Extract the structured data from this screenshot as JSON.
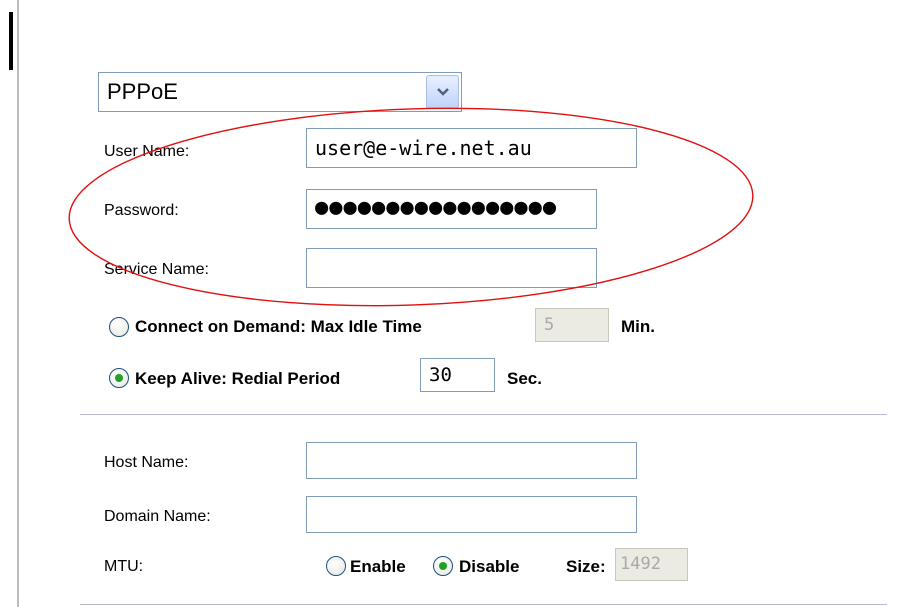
{
  "connection": {
    "type_options": [
      "PPPoE"
    ],
    "type_selected": "PPPoE"
  },
  "credentials": {
    "user_name_label": "User Name:",
    "user_name_value": "user@e-wire.net.au",
    "password_label": "Password:",
    "password_value": "●●●●●●●●●●●●●●●●●",
    "service_name_label": "Service Name:",
    "service_name_value": ""
  },
  "connect_mode": {
    "on_demand_label": "Connect on Demand: Max Idle Time",
    "on_demand_selected": false,
    "max_idle_value": "5",
    "max_idle_unit": "Min.",
    "keep_alive_label": "Keep Alive: Redial Period",
    "keep_alive_selected": true,
    "redial_value": "30",
    "redial_unit": "Sec."
  },
  "optional": {
    "host_name_label": "Host Name:",
    "host_name_value": "",
    "domain_name_label": "Domain Name:",
    "domain_name_value": "",
    "mtu_label": "MTU:",
    "mtu_enable_label": "Enable",
    "mtu_enable_selected": false,
    "mtu_disable_label": "Disable",
    "mtu_disable_selected": true,
    "mtu_size_label": "Size:",
    "mtu_size_value": "1492"
  },
  "colors": {
    "annotation_ellipse": "#e01010",
    "input_border": "#7f9db9",
    "radio_dot": "#21a121"
  },
  "icons": {
    "dropdown": "chevron-down-icon"
  }
}
